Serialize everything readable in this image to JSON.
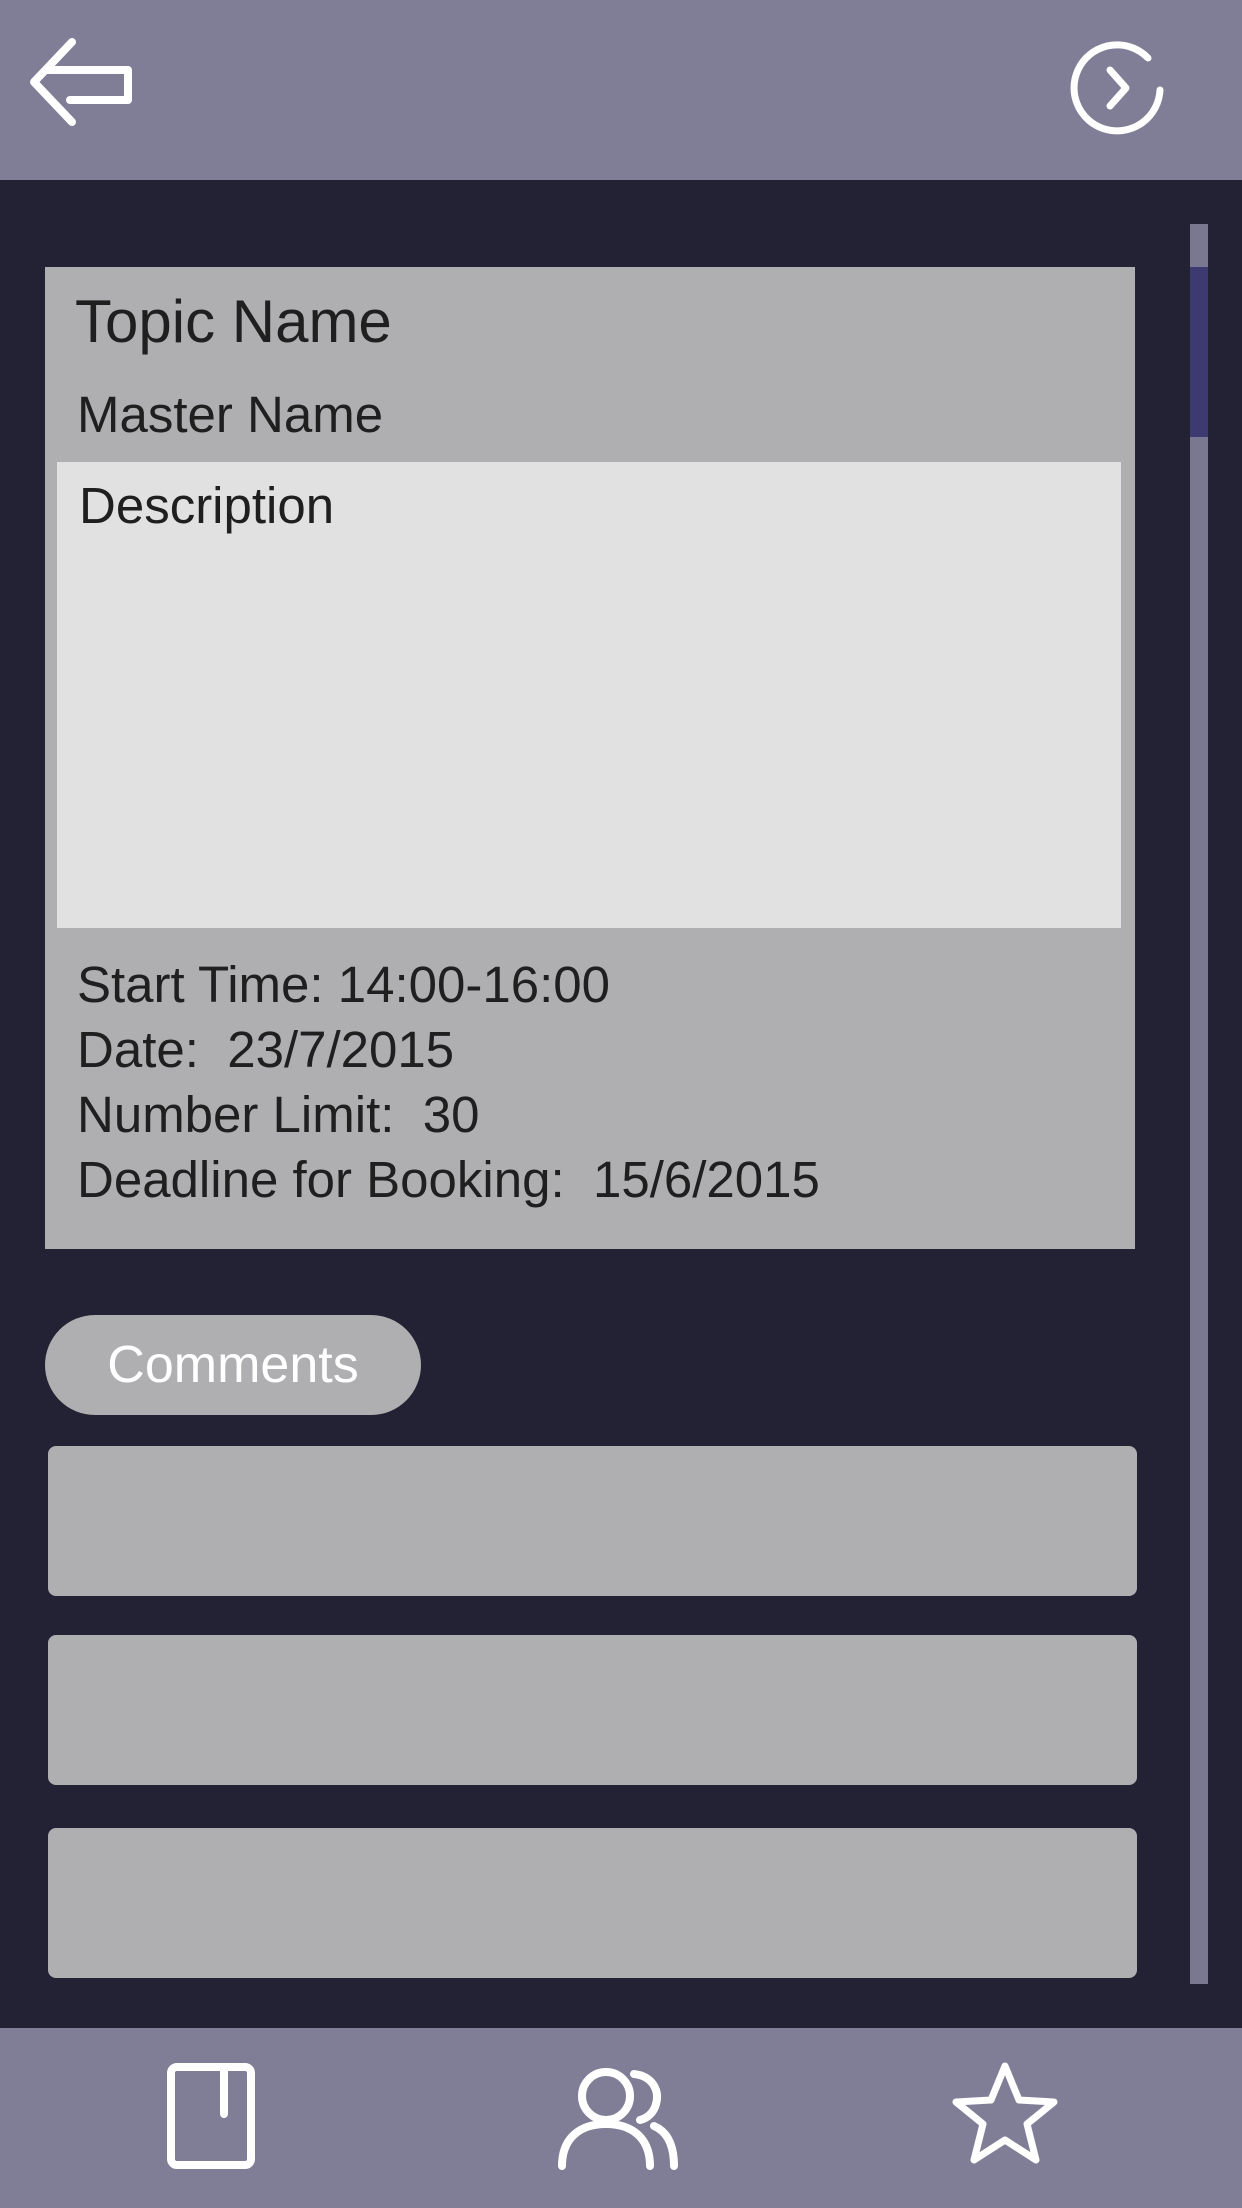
{
  "header": {
    "back_icon": "back-arrow-icon",
    "forward_icon": "chevron-right-circle-icon"
  },
  "event": {
    "topic_name": "Topic Name",
    "master_name": "Master Name",
    "description": "Description",
    "start_time": "Start Time: 14:00-16:00",
    "date": "Date:  23/7/2015",
    "number_limit": "Number Limit:  30",
    "deadline": "Deadline for Booking:  15/6/2015"
  },
  "comments": {
    "label": "Comments"
  },
  "bottom_nav": {
    "items": [
      {
        "icon": "book-icon"
      },
      {
        "icon": "people-icon"
      },
      {
        "icon": "star-icon"
      }
    ]
  },
  "colors": {
    "bar": "#807e96",
    "background": "#232234",
    "card": "#afafb1",
    "description": "#e1e1e2",
    "scroll_thumb": "#3d3a72"
  }
}
